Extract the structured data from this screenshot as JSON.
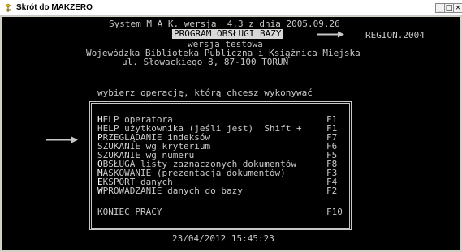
{
  "window": {
    "title": "Skrót do MAKZERO",
    "min_label": "_",
    "max_label": "□",
    "close_label": "×"
  },
  "header": {
    "line1": "System M A K. wersja  4.3 z dnia 2005.09.26",
    "program_label": "PROGRAM OBSŁUGI BAZY",
    "region": "REGION.2004",
    "line3": "wersja testowa",
    "line4": "Wojewódzka Biblioteka Publiczna i Książnica Miejska",
    "line5": "ul. Słowackiego 8, 87-100 TORUŃ"
  },
  "prompt": "wybierz operację, którą chcesz wykonywać",
  "menu": {
    "items": [
      {
        "hotkey": "H",
        "rest": "ELP operatora",
        "key": "F1",
        "selected": false
      },
      {
        "hotkey": "HELP u",
        "rest": "żytkownika (jeśli jest)  Shift + ",
        "key": "F1",
        "selected": false
      },
      {
        "hotkey": "P",
        "rest": "RZEGLĄDANIE indeksów",
        "key": "F7",
        "selected": true
      },
      {
        "hotkey": "SZUKANIE wg k",
        "rest": "ryterium",
        "key": "F6",
        "selected": false
      },
      {
        "hotkey": "SZUKANIE wg n",
        "rest": "umeru",
        "key": "F5",
        "selected": false
      },
      {
        "hotkey": "O",
        "rest": "BSŁUGA listy zaznaczonych dokumentów",
        "key": "F8",
        "selected": false
      },
      {
        "hotkey": "M",
        "rest": "ASKOWANIE (prezentacja dokumentów)",
        "key": "F3",
        "selected": false
      },
      {
        "hotkey": "E",
        "rest": "KSPORT danych",
        "key": "F4",
        "selected": false
      },
      {
        "hotkey": "W",
        "rest": "PROWADZANIE danych do bazy",
        "key": "F2",
        "selected": false
      }
    ],
    "exit": {
      "label": "KONIEC PRACY",
      "key": "F10"
    }
  },
  "footer": {
    "datetime": "23/04/2012 15:45:23"
  }
}
